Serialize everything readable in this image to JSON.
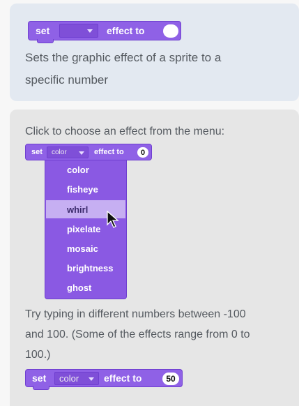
{
  "top": {
    "block": {
      "set": "set",
      "effect_to": "effect to"
    },
    "description": [
      "Sets the graphic effect of a sprite to a",
      "specific number"
    ]
  },
  "bottom": {
    "instruction": "Click to choose an effect from the menu:",
    "block1": {
      "set": "set",
      "dropdown": "color",
      "effect_to": "effect to",
      "value": "0"
    },
    "menu": {
      "items": [
        "color",
        "fisheye",
        "whirl",
        "pixelate",
        "mosaic",
        "brightness",
        "ghost"
      ],
      "selected": "whirl"
    },
    "hint": [
      "Try typing in different numbers between -100",
      "and 100. (Some of the effects range from 0 to",
      "100.)"
    ],
    "block2": {
      "set": "set",
      "dropdown": "color",
      "effect_to": "effect to",
      "value": "50"
    }
  },
  "colors": {
    "block": "#8f61e6",
    "menu_highlight": "#c6aff2",
    "card_top": "#e3e9f1",
    "card_bottom": "#e6e6e6"
  }
}
